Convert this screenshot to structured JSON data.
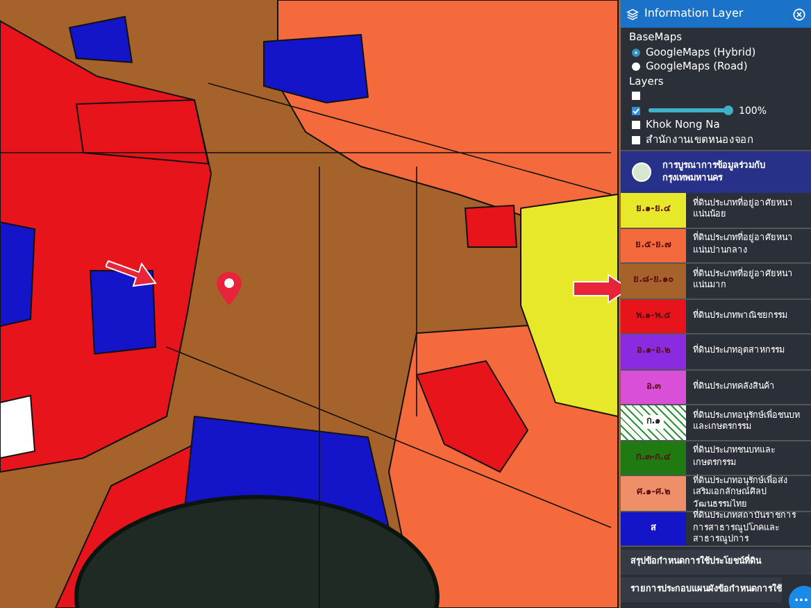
{
  "panel": {
    "title": "Information Layer",
    "basemaps_label": "BaseMaps",
    "basemaps": [
      {
        "label": "GoogleMaps (Hybrid)",
        "selected": true
      },
      {
        "label": "GoogleMaps (Road)",
        "selected": false
      }
    ],
    "layers_label": "Layers",
    "layers": [
      {
        "kind": "checkbox",
        "checked": false
      },
      {
        "kind": "opacity",
        "checked": true,
        "level": 1,
        "reading": "100%"
      },
      {
        "kind": "checkbox",
        "checked": false,
        "label": "Khok Nong Na"
      },
      {
        "kind": "checkbox",
        "checked": false,
        "label": "สำนักงานเขตหนองจอก"
      }
    ],
    "banner": {
      "title": "การบูรณาการข้อมูลร่วมกับกรุงเทพมหานคร"
    },
    "legend": [
      {
        "kind": "solid",
        "color": "#e8e82a",
        "code": "ย.๑-ย.๔",
        "description": "ที่ดินประเภทที่อยู่อาศัยหนาแน่นน้อย"
      },
      {
        "kind": "solid",
        "color": "#f46a3c",
        "code": "ย.๕-ย.๗",
        "description": "ที่ดินประเภทที่อยู่อาศัยหนาแน่นปานกลาง"
      },
      {
        "kind": "solid",
        "color": "#a5622a",
        "code": "ย.๘-ย.๑๐",
        "description": "ที่ดินประเภทที่อยู่อาศัยหนาแน่นมาก"
      },
      {
        "kind": "solid",
        "color": "#e8141c",
        "code": "พ.๑-พ.๕",
        "description": "ที่ดินประเภทพาณิชยกรรม"
      },
      {
        "kind": "solid",
        "color": "#8a2be2",
        "code": "อ.๑-อ.๒",
        "description": "ที่ดินประเภทอุตสาหกรรม"
      },
      {
        "kind": "solid",
        "color": "#d94fd8",
        "code": "อ.๓",
        "description": "ที่ดินประเภทคลังสินค้า"
      },
      {
        "kind": "hatched",
        "color": "#2e9a3a",
        "code": "ก.๑",
        "description": "ที่ดินประเภทอนุรักษ์เพื่อชนบทและเกษตรกรรม"
      },
      {
        "kind": "solid",
        "color": "#1f7a12",
        "code": "ก.๓-ก.๔",
        "description": "ที่ดินประเภทชนบทและเกษตรกรรม"
      },
      {
        "kind": "solid",
        "color": "#ee8f6a",
        "code": "ศ.๑-ศ.๒",
        "description": "ที่ดินประเภทอนุรักษ์เพื่อส่งเสริมเอกลักษณ์ศิลปวัฒนธรรมไทย"
      },
      {
        "kind": "solid",
        "color": "#1414c8",
        "code": "ส",
        "description": "ที่ดินประเภทสถาบันราชการการสาธารณูปโภคและสาธารณูปการ"
      }
    ],
    "buttons": [
      "สรุปข้อกำหนดการใช้ประโยชน์ที่ดิน",
      "รายการประกอบแผนผังข้อกำหนดการใช้"
    ],
    "fab": "..."
  }
}
